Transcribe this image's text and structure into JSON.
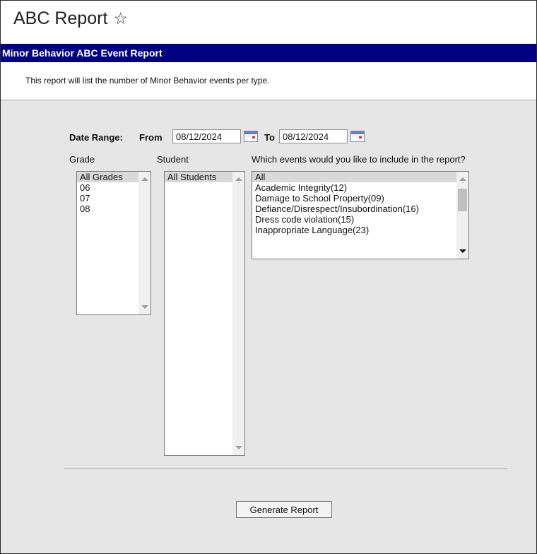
{
  "page": {
    "title": "ABC Report",
    "star_icon": "star-outline-icon"
  },
  "header": {
    "title": "Minor Behavior ABC Event Report"
  },
  "description": "This report will list the number of Minor Behavior events per type.",
  "form": {
    "date_range_label": "Date Range:",
    "from_label": "From",
    "from_value": "08/12/2024",
    "to_label": "To",
    "to_value": "08/12/2024",
    "grade": {
      "label": "Grade",
      "options": [
        "All Grades",
        "06",
        "07",
        "08"
      ],
      "selected": "All Grades"
    },
    "student": {
      "label": "Student",
      "options": [
        "All Students"
      ],
      "selected": "All Students"
    },
    "events": {
      "label": "Which events would you like to include in the report?",
      "options": [
        "All",
        "Academic Integrity(12)",
        "Damage to School Property(09)",
        "Defiance/Disrespect/Insubordination(16)",
        "Dress code violation(15)",
        "Inappropriate Language(23)"
      ],
      "selected": "All"
    },
    "generate_label": "Generate Report"
  },
  "colors": {
    "header_bg": "#000080",
    "panel_bg": "#e6e6e6",
    "selected_bg": "#d9d9d9"
  }
}
